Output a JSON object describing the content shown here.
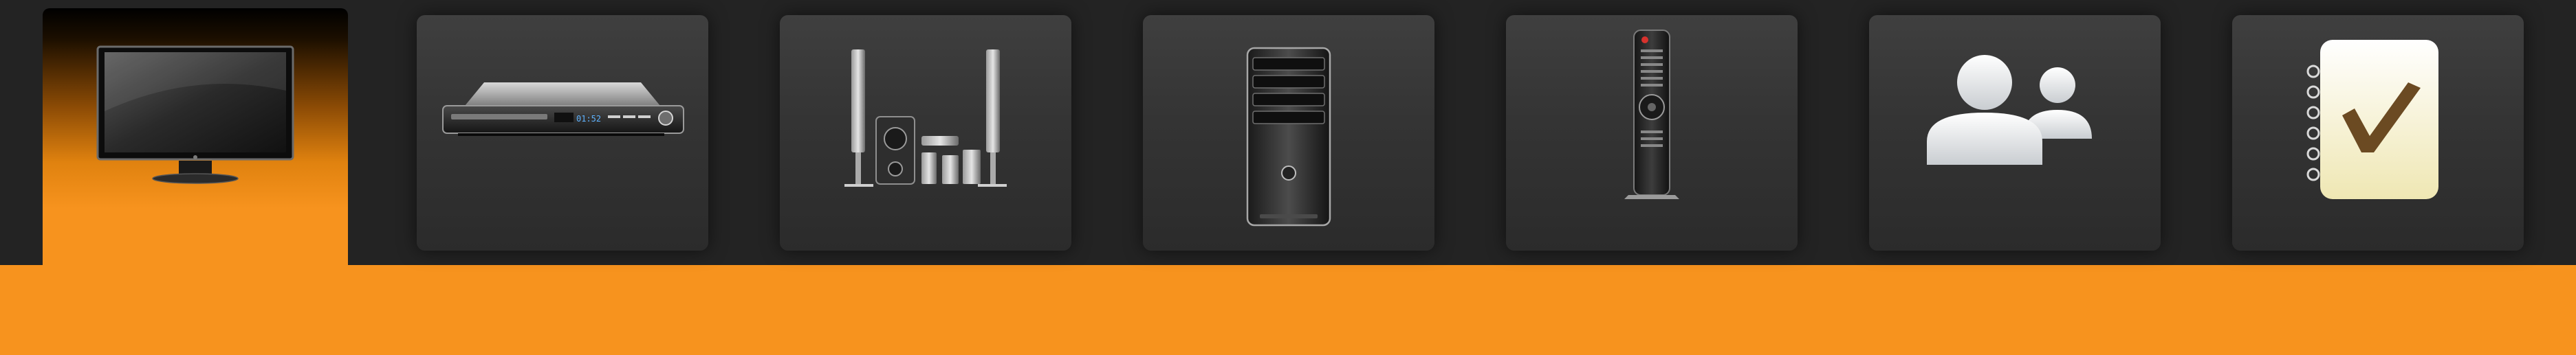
{
  "menu": {
    "active_index": 0,
    "items": [
      {
        "icon": "monitor-icon",
        "selected": true
      },
      {
        "icon": "dvd-player-icon",
        "selected": false
      },
      {
        "icon": "home-theater-speakers-icon",
        "selected": false
      },
      {
        "icon": "pc-tower-icon",
        "selected": false
      },
      {
        "icon": "remote-control-icon",
        "selected": false
      },
      {
        "icon": "users-icon",
        "selected": false
      },
      {
        "icon": "checklist-notepad-icon",
        "selected": false
      }
    ]
  },
  "devices": {
    "dvd_display": "01:52"
  },
  "colors": {
    "accent": "#F7931E",
    "background": "#232323",
    "tile": "#363636"
  }
}
